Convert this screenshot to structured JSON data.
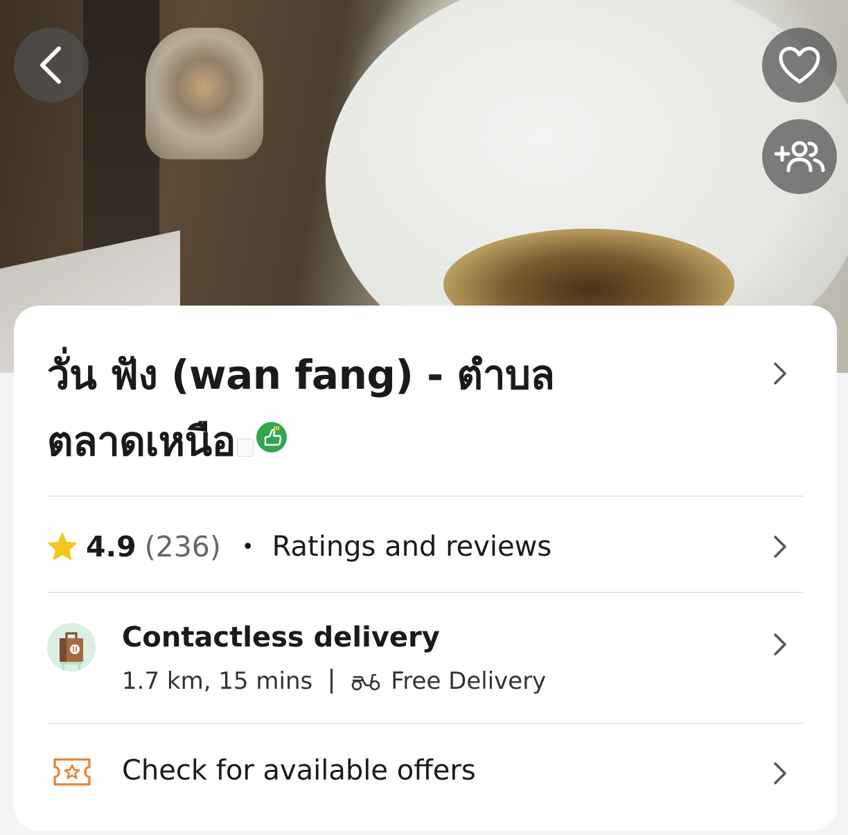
{
  "hero": {
    "back_icon": "chevron-left-icon",
    "favorite_icon": "heart-icon",
    "group_order_icon": "add-group-icon"
  },
  "restaurant": {
    "name": "วั่น ฟัง (wan fang) - ตำบลตลาดเหนือ",
    "badge_icon": "thumbs-up-icon",
    "badge_color": "#2fa84f"
  },
  "rating": {
    "value": "4.9",
    "count": "(236)",
    "separator": "•",
    "link_label": "Ratings and reviews",
    "star_color": "#f5c518"
  },
  "delivery": {
    "title": "Contactless delivery",
    "distance_time": "1.7 km, 15 mins",
    "fee_label": "Free Delivery",
    "icon": "delivery-bag-icon",
    "fee_icon": "scooter-icon"
  },
  "offers": {
    "label": "Check for available offers",
    "icon": "ticket-star-icon",
    "icon_color": "#e8833a"
  }
}
